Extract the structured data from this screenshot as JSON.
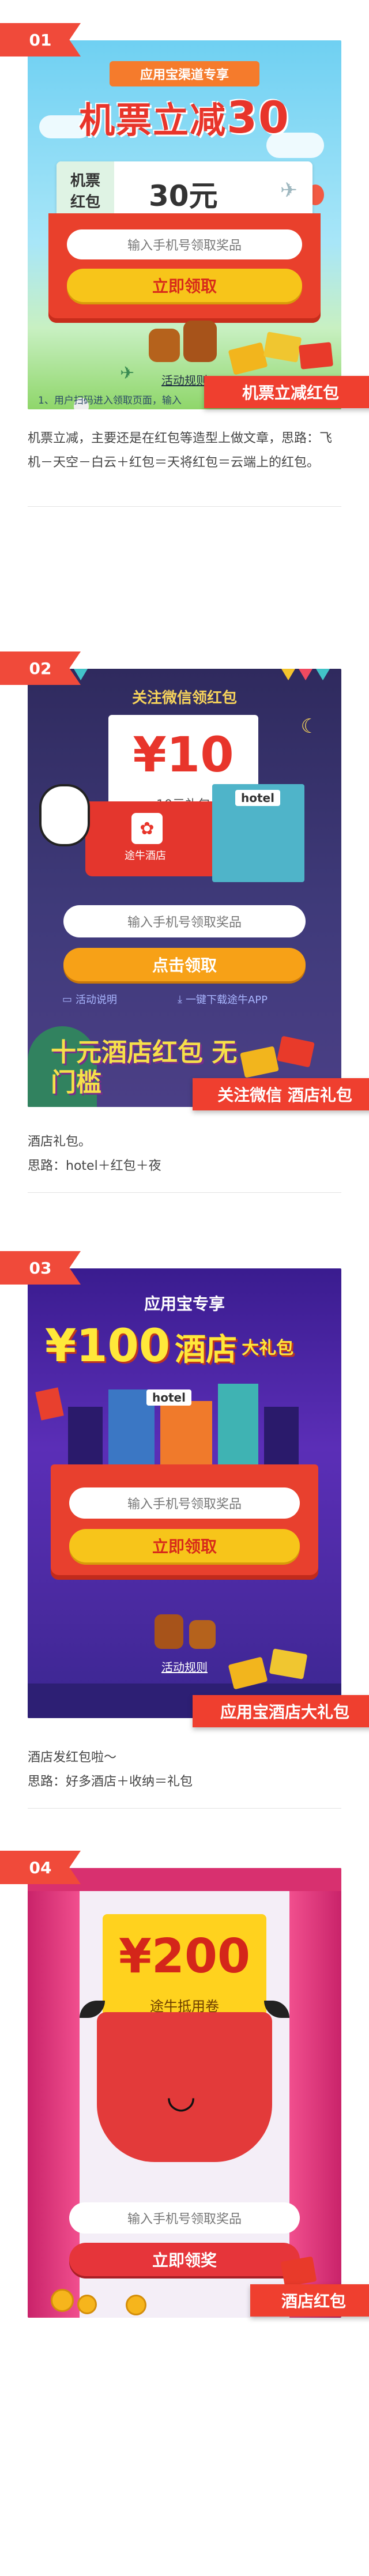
{
  "sections": [
    {
      "badge": "01",
      "banner_tag": "应用宝渠道专享",
      "headline": "机票立减",
      "headline_amount": "30",
      "hongbao_label_1": "机票",
      "hongbao_label_2": "红包",
      "amount_text": "30元",
      "input_placeholder": "输入手机号领取奖品",
      "claim_button": "立即领取",
      "rules_link": "活动规则",
      "rule_text": "1、用户扫码进入领取页面，输入",
      "corner_banner": "机票立减红包",
      "description": [
        "机票立减，主要还是在红包等造型上做文章，思路：飞机－天空－白云＋红包＝天将红包＝云端上的红包。"
      ]
    },
    {
      "badge": "02",
      "top_text": "关注微信领红包",
      "amount": "¥10",
      "amount_caption": "10元礼包",
      "brand": "途牛酒店",
      "hotel_sign": "hotel",
      "input_placeholder": "输入手机号领取奖品",
      "claim_button": "点击领取",
      "link_rules": "活动说明",
      "link_download": "一键下载途牛APP",
      "bottom_art": "十元酒店红包 无门槛",
      "corner_banner": "关注微信 酒店礼包",
      "description": [
        "酒店礼包。",
        "思路：hotel＋红包＋夜"
      ]
    },
    {
      "badge": "03",
      "top_text": "应用宝专享",
      "amount": "¥100",
      "headline": "酒店",
      "headline_2": "大礼包",
      "hotel_sign": "hotel",
      "input_placeholder": "输入手机号领取奖品",
      "claim_button": "立即领取",
      "rules_link": "活动规则",
      "corner_banner": "应用宝酒店大礼包",
      "description": [
        "酒店发红包啦～",
        "思路：好多酒店＋收纳＝礼包"
      ]
    },
    {
      "badge": "04",
      "amount": "¥200",
      "amount_caption": "途牛抵用卷",
      "input_placeholder": "输入手机号领取奖品",
      "claim_button": "立即领奖",
      "corner_banner": "酒店红包"
    }
  ],
  "colors": {
    "badge_red": "#f04a3a",
    "button_yellow": "#f7c51a",
    "button_orange": "#f7a117",
    "night_purple": "#3a2d6e",
    "stage_pink": "#f14f8e"
  }
}
